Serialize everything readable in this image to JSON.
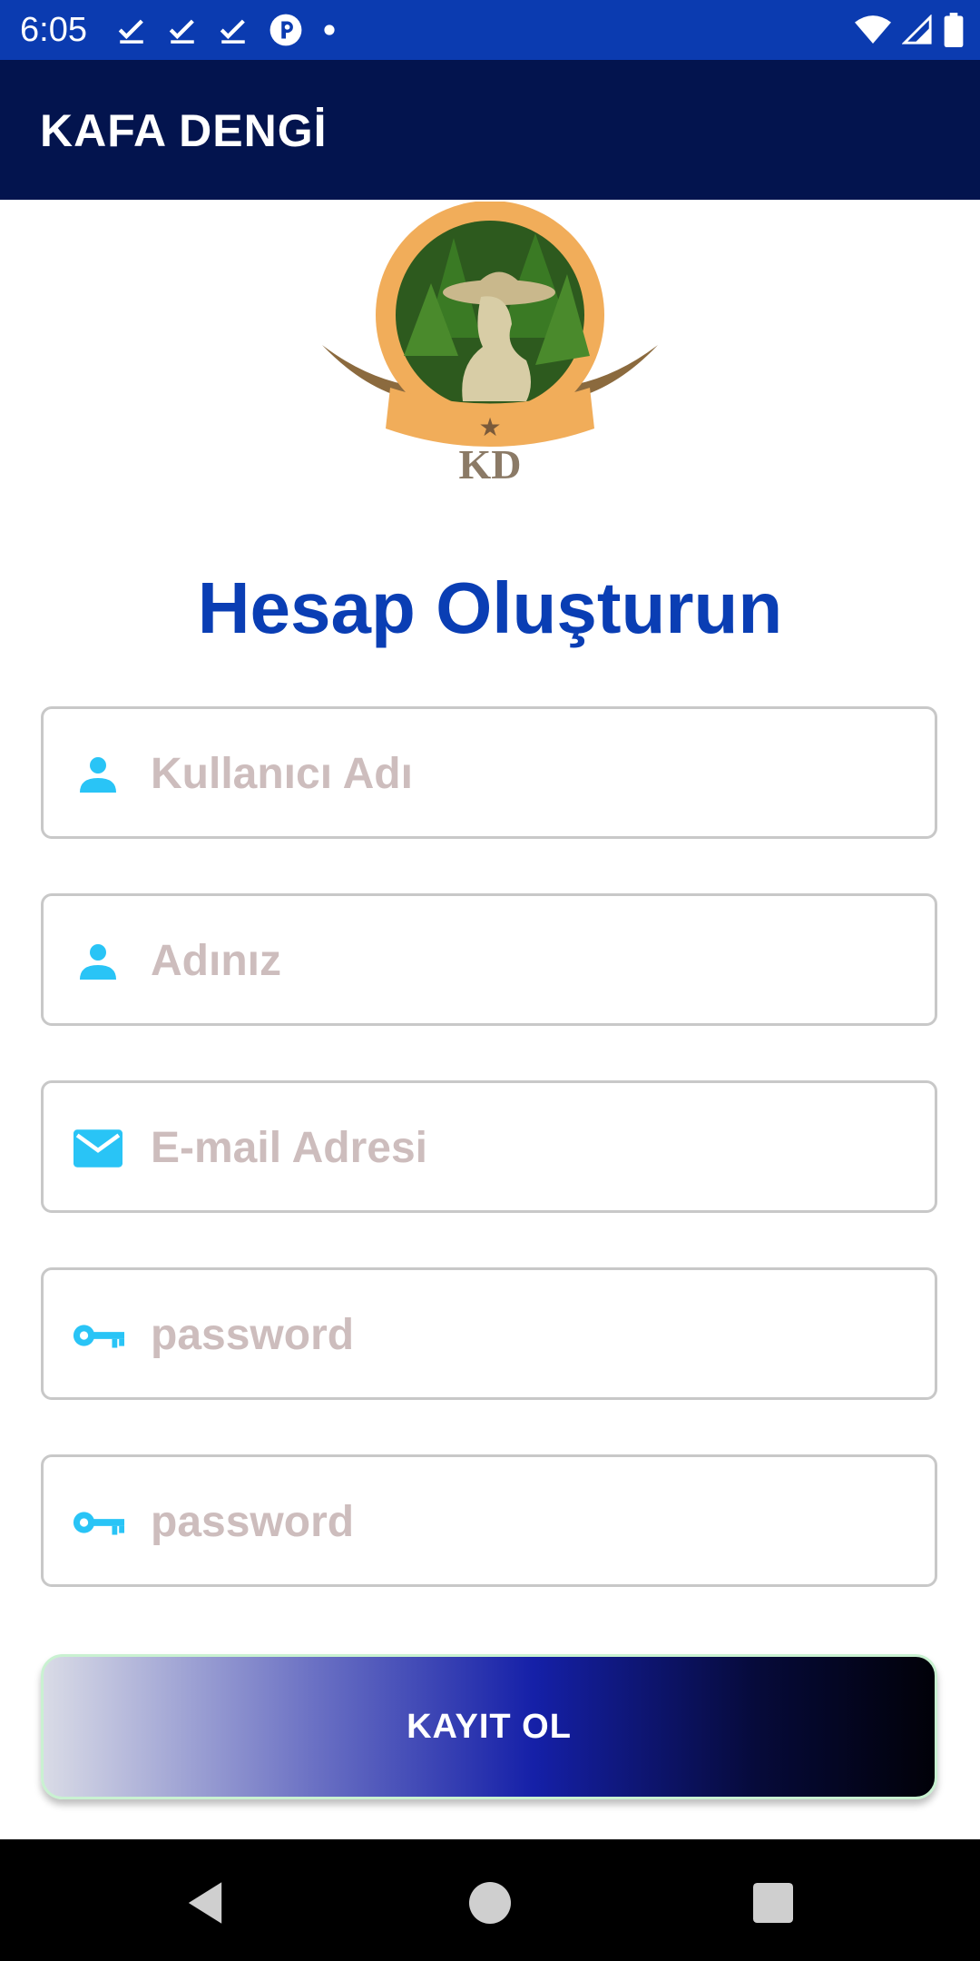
{
  "status_bar": {
    "time": "6:05",
    "left_icons": [
      "check-icon",
      "check-icon",
      "check-icon",
      "app-p-icon",
      "dot-icon"
    ],
    "right_icons": [
      "wifi-icon",
      "signal-icon",
      "battery-icon"
    ]
  },
  "app_bar": {
    "title": "KAFA DENGİ"
  },
  "logo": {
    "text": "KD"
  },
  "heading": "Hesap Oluşturun",
  "form": {
    "username": {
      "placeholder": "Kullanıcı Adı",
      "value": "",
      "icon": "person-icon"
    },
    "name": {
      "placeholder": "Adınız",
      "value": "",
      "icon": "person-icon"
    },
    "email": {
      "placeholder": "E-mail Adresi",
      "value": "",
      "icon": "email-icon"
    },
    "password": {
      "placeholder": "password",
      "value": "",
      "icon": "key-icon"
    },
    "password_confirm": {
      "placeholder": "password",
      "value": "",
      "icon": "key-icon"
    }
  },
  "register_button": {
    "label": "KAYIT OL"
  },
  "colors": {
    "status_bar": "#0b3bb0",
    "app_bar": "#03144e",
    "heading": "#0a3eb4",
    "icon": "#29c4f6",
    "placeholder": "#cdbdbd"
  }
}
